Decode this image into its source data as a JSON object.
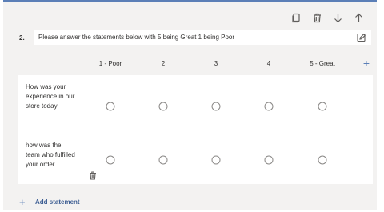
{
  "question": {
    "number": "2.",
    "text": "Please answer the statements below with 5 being Great 1 being Poor"
  },
  "columns": [
    "1 - Poor",
    "2",
    "3",
    "4",
    "5 - Great"
  ],
  "statements": [
    {
      "label": "How was your experience in our store today"
    },
    {
      "label": "how was the team who fulfilled your order"
    }
  ],
  "add_statement_label": "Add statement",
  "toolbar": {
    "icons": [
      "copy-icon",
      "trash-icon",
      "arrow-down-icon",
      "arrow-up-icon"
    ]
  },
  "colors": {
    "accent": "#5b7fb7",
    "card_bg": "#f3f2f1",
    "row_bg": "#ffffff"
  }
}
